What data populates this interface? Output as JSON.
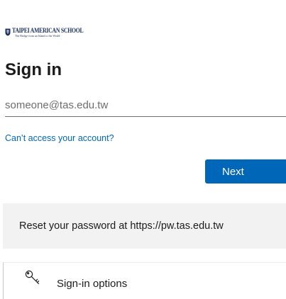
{
  "logo": {
    "name": "TAIPEI AMERICAN SCHOOL",
    "tagline": "The Bridge from an Island to the World",
    "color": "#1b2f5e"
  },
  "signin": {
    "title": "Sign in",
    "email_placeholder": "someone@tas.edu.tw",
    "email_value": "",
    "cant_access_link": "Can’t access your account?",
    "next_label": "Next"
  },
  "reset": {
    "text": "Reset your password at https://pw.tas.edu.tw"
  },
  "options": {
    "label": "Sign-in options",
    "icon": "key-icon"
  },
  "colors": {
    "accent": "#0067b8",
    "banner_bg": "#f2f2f2",
    "text": "#1b1b1b"
  }
}
